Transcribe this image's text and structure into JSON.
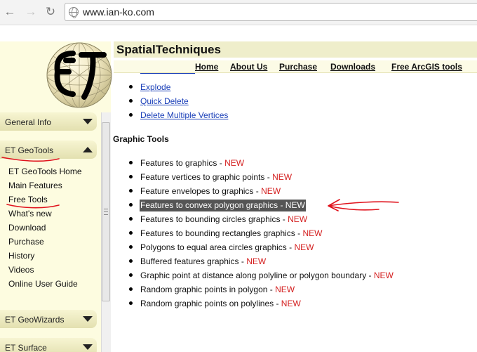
{
  "browser": {
    "url": "www.ian-ko.com",
    "back_icon": "back-arrow-icon",
    "forward_icon": "forward-arrow-icon",
    "reload_icon": "reload-icon",
    "site_icon": "globe-icon"
  },
  "header": {
    "brand": "SpatialTechniques",
    "logo_letters": "ET",
    "nav": [
      "Home",
      "About Us",
      "Purchase",
      "Downloads",
      "Free ArcGIS tools"
    ]
  },
  "sidebar": {
    "sections": [
      {
        "label": "General Info",
        "state": "collapsed"
      },
      {
        "label": "ET GeoTools",
        "state": "expanded"
      },
      {
        "label": "ET GeoWizards",
        "state": "collapsed"
      },
      {
        "label": "ET Surface",
        "state": "collapsed"
      }
    ],
    "geotools_links": [
      "ET GeoTools Home",
      "Main Features",
      "Free Tools",
      "What's new",
      "Download",
      "Purchase",
      "History",
      "Videos",
      "Online User Guide"
    ]
  },
  "content": {
    "top_links": [
      "Explode",
      "Quick Delete",
      "Delete Multiple Vertices"
    ],
    "section_title": "Graphic Tools",
    "new_label": "NEW",
    "graphic_tools": [
      "Features to graphics - ",
      "Feature vertices to graphic points - ",
      "Feature envelopes to graphics - ",
      "Features to convex polygon graphics - ",
      "Features to bounding circles graphics - ",
      "Features to bounding rectangles graphics - ",
      "Polygons to equal area circles graphics - ",
      "Buffered features graphics - ",
      "Graphic point at distance along polyline or polygon boundary - ",
      "Random graphic points in polygon - ",
      "Random graphic points on polylines - "
    ],
    "highlighted_index": 3
  },
  "colors": {
    "sidebar_bg": "#fdfce0",
    "brand_bar": "#efeecb",
    "link": "#1a3fb8",
    "new": "#d42020",
    "annotation": "#e0121c",
    "highlight": "#555555"
  }
}
